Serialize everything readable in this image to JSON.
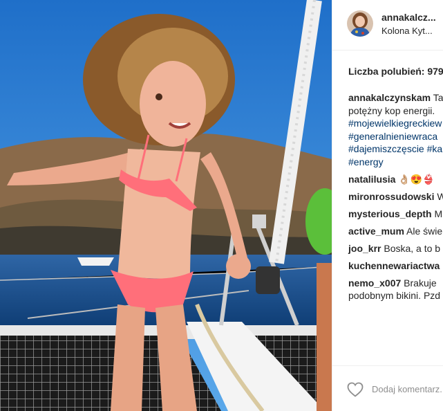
{
  "post": {
    "username": "annakalcz...",
    "location": "Kolona Kyt...",
    "likes_label": "Liczba polubień: 979"
  },
  "caption": {
    "user": "annakalczynskam",
    "text_line1_tail": " Ta",
    "line2": "potężny kop energii.",
    "hashtags": [
      "#mojewielkiegreckiew",
      "#generalnieniewraca",
      "#dajemiszczęscie",
      "#ka",
      "#energy"
    ]
  },
  "comments": [
    {
      "user": "natalilusia",
      "text": " 👌🏼😍👙"
    },
    {
      "user": "mironrossudowski",
      "text": " W"
    },
    {
      "user": "mysterious_depth",
      "text": " M"
    },
    {
      "user": "active_mum",
      "text": " Ale świe"
    },
    {
      "user": "joo_krr",
      "text": " Boska, a to b"
    },
    {
      "user": "kuchennewariactwa",
      "text": ""
    },
    {
      "user": "nemo_x007",
      "text": " Brakuje",
      "line2": "podobnym bikini. Pzd"
    }
  ],
  "footer": {
    "add_comment_placeholder": "Dodaj komentarz...",
    "like_icon": "heart-outline-icon"
  },
  "colors": {
    "text": "#262626",
    "hashtag": "#003569",
    "placeholder": "#8e8e8e",
    "divider": "#efefef"
  }
}
